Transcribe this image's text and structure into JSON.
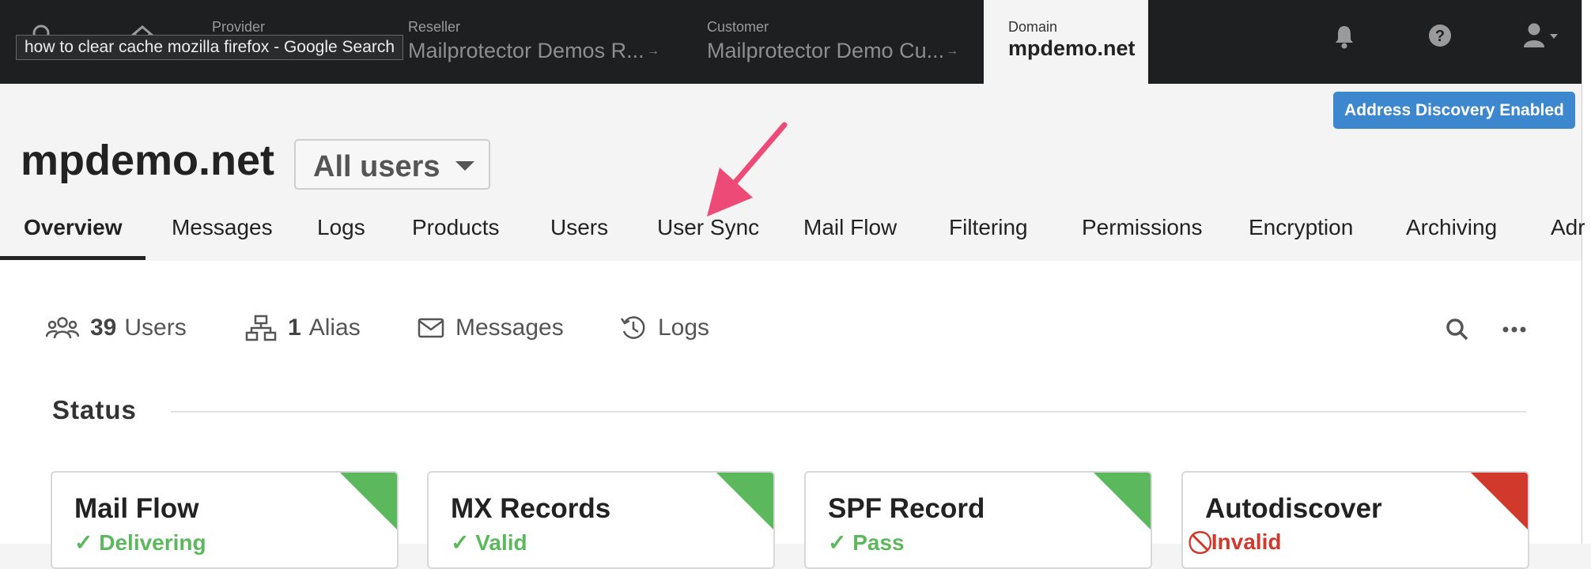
{
  "breadcrumbs": [
    {
      "label": "Provider",
      "value": ""
    },
    {
      "label": "Reseller",
      "value": "Mailprotector Demos R..."
    },
    {
      "label": "Customer",
      "value": "Mailprotector Demo Cu..."
    }
  ],
  "active_crumb": {
    "label": "Domain",
    "value": "mpdemo.net"
  },
  "tooltip": "how to clear cache mozilla firefox - Google Search",
  "address_discovery": "Address Discovery Enabled",
  "page_title": "mpdemo.net",
  "user_filter": "All users",
  "tabs": [
    "Overview",
    "Messages",
    "Logs",
    "Products",
    "Users",
    "User Sync",
    "Mail Flow",
    "Filtering",
    "Permissions",
    "Encryption",
    "Archiving",
    "Adr"
  ],
  "stats": {
    "users_count": "39",
    "users_label": "Users",
    "alias_count": "1",
    "alias_label": "Alias",
    "messages_label": "Messages",
    "logs_label": "Logs"
  },
  "status_heading": "Status",
  "cards": [
    {
      "title": "Mail Flow",
      "status": "✓ Delivering",
      "color": "#5cb85c"
    },
    {
      "title": "MX Records",
      "status": "✓ Valid",
      "color": "#5cb85c"
    },
    {
      "title": "SPF Record",
      "status": "✓ Pass",
      "color": "#5cb85c"
    },
    {
      "title": "Autodiscover",
      "status": "⃠ Invalid",
      "color": "#d0392b"
    }
  ],
  "colors": {
    "accent": "#3d87cf",
    "ok": "#5cb85c",
    "error": "#d0392b",
    "annotation_arrow": "#ee4a78"
  }
}
